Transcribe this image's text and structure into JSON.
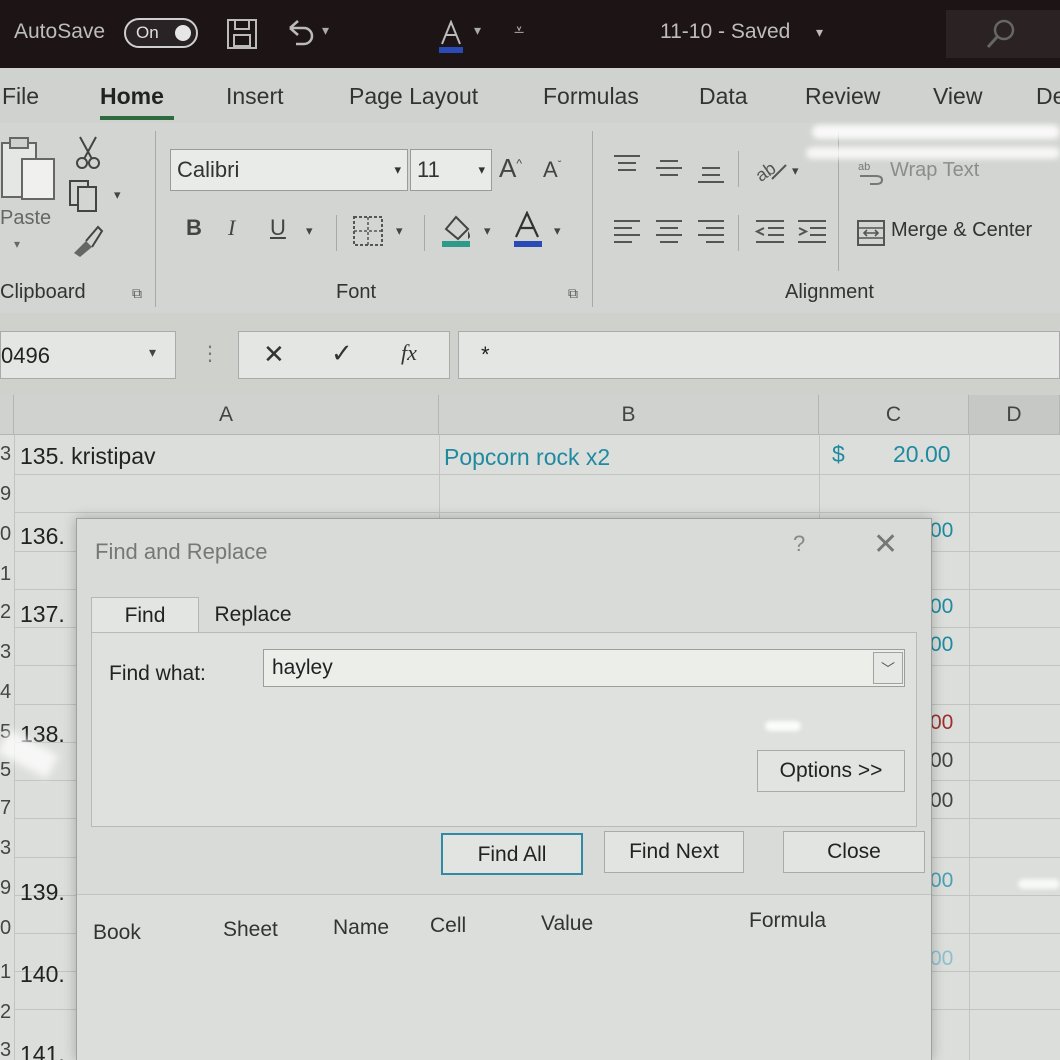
{
  "titlebar": {
    "autosave_label": "AutoSave",
    "autosave_state": "On",
    "document_title": "11-10 - Saved",
    "title_chevron": "▾"
  },
  "ribbon": {
    "tabs": [
      "File",
      "Home",
      "Insert",
      "Page Layout",
      "Formulas",
      "Data",
      "Review",
      "View",
      "De"
    ],
    "active_tab": "Home",
    "clipboard": {
      "paste_label": "Paste",
      "group_label": "Clipboard"
    },
    "font": {
      "font_name": "Calibri",
      "font_size": "11",
      "bold": "B",
      "italic": "I",
      "underline": "U",
      "group_label": "Font"
    },
    "alignment": {
      "wrap_text_label": "Wrap Text",
      "merge_center_label": "Merge & Center",
      "group_label": "Alignment"
    }
  },
  "formula_bar": {
    "name_box": "0496",
    "fx": "fx",
    "formula_value": "*"
  },
  "sheet": {
    "columns": [
      "A",
      "B",
      "C",
      "D"
    ],
    "row_numbers": [
      "3",
      "9",
      "0",
      "1",
      "2",
      "3",
      "4",
      "5",
      "5",
      "7",
      "3",
      "9",
      "0",
      "1",
      "2",
      "3"
    ],
    "cells": {
      "a_135": "135. kristipav",
      "b_135": "Popcorn rock x2",
      "c_135_currency": "$",
      "c_135_amount": "20.00",
      "a_136": "136.",
      "a_137": "137.",
      "a_138": "138.",
      "a_139": "139.",
      "a_140": "140.",
      "a_141": "141."
    },
    "partial_values": [
      "00",
      "00",
      "00",
      "00",
      "00",
      "00",
      "00",
      "00"
    ]
  },
  "dialog": {
    "title": "Find and Replace",
    "help": "?",
    "close_glyph": "✕",
    "tabs": {
      "find": "Find",
      "replace": "Replace"
    },
    "find_what_label": "Find what:",
    "find_what_value": "hayley",
    "options_button": "Options >>",
    "find_all_button": "Find All",
    "find_next_button": "Find Next",
    "close_button": "Close",
    "results_columns": [
      "Book",
      "Sheet",
      "Name",
      "Cell",
      "Value",
      "Formula"
    ]
  },
  "colors": {
    "titlebar_bg": "#1d1416",
    "active_tab_underline": "#2d6a3e",
    "hyperlink_teal": "#1f8aa0",
    "primary_button_border": "#2f8aa6"
  }
}
